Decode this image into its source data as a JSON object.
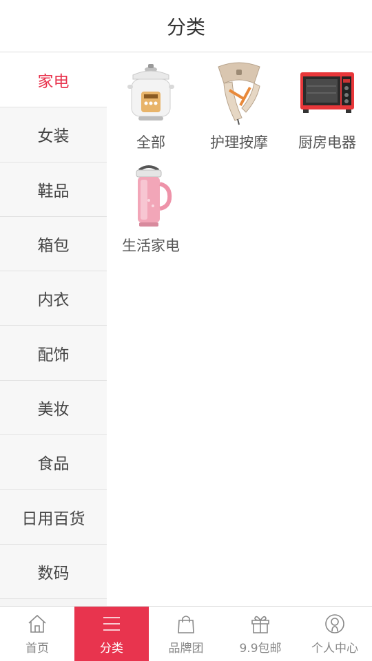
{
  "header": {
    "title": "分类"
  },
  "sidebar": {
    "items": [
      {
        "label": "家电"
      },
      {
        "label": "女装"
      },
      {
        "label": "鞋品"
      },
      {
        "label": "箱包"
      },
      {
        "label": "内衣"
      },
      {
        "label": "配饰"
      },
      {
        "label": "美妆"
      },
      {
        "label": "食品"
      },
      {
        "label": "日用百货"
      },
      {
        "label": "数码"
      }
    ],
    "active_index": 0
  },
  "content": {
    "subcategories": [
      {
        "label": "全部",
        "image": "slow-cooker"
      },
      {
        "label": "护理按摩",
        "image": "neck-massager"
      },
      {
        "label": "厨房电器",
        "image": "toaster-oven"
      },
      {
        "label": "生活家电",
        "image": "soymilk-maker"
      }
    ]
  },
  "tabbar": {
    "items": [
      {
        "label": "首页",
        "icon": "home-icon"
      },
      {
        "label": "分类",
        "icon": "menu-icon"
      },
      {
        "label": "品牌团",
        "icon": "bag-icon"
      },
      {
        "label": "9.9包邮",
        "icon": "gift-icon"
      },
      {
        "label": "个人中心",
        "icon": "user-icon"
      }
    ],
    "active_index": 1
  },
  "colors": {
    "accent": "#e8344e",
    "sidebar_bg": "#f7f7f7"
  }
}
